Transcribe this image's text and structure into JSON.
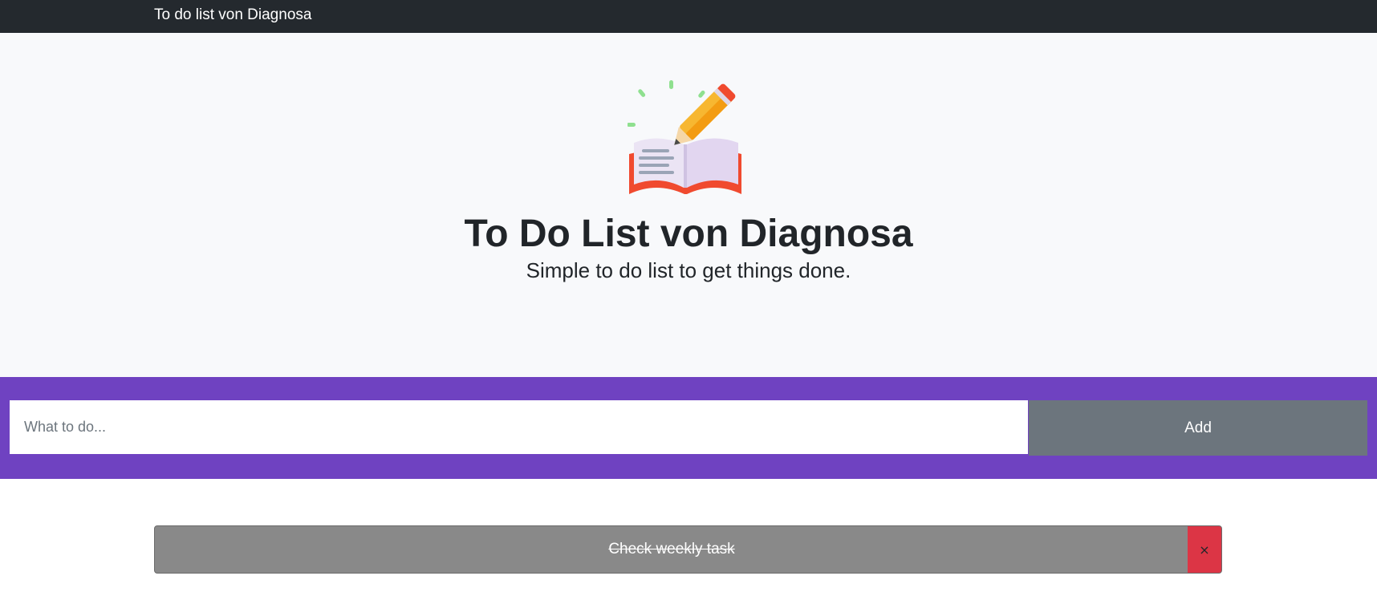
{
  "navbar": {
    "brand": "To do list von Diagnosa"
  },
  "hero": {
    "logo_icon": "book-pencil-icon",
    "title": "To Do List von Diagnosa",
    "subtitle": "Simple to do list to get things done."
  },
  "form": {
    "placeholder": "What to do...",
    "value": "",
    "add_label": "Add"
  },
  "todos": [
    {
      "text": "Check weekly task",
      "completed": true,
      "delete_label": "×"
    }
  ],
  "colors": {
    "navbar": "#24292e",
    "hero_bg": "#f8f9fb",
    "accent": "#6f42c1",
    "add_button": "#6c757d",
    "completed_item": "#898989",
    "delete_button": "#dc3545"
  }
}
